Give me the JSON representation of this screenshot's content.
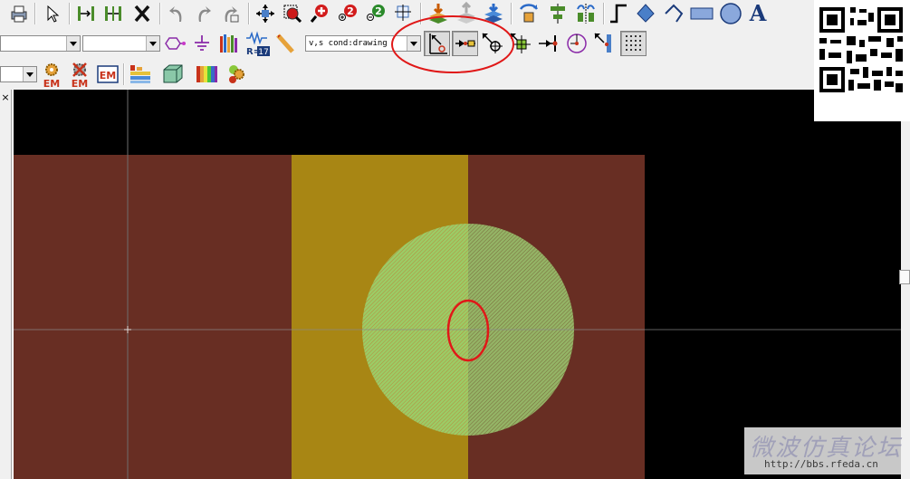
{
  "toolbar": {
    "top_row": {
      "icons": [
        "print-icon",
        "select-pointer-icon",
        "dimension-left-icon",
        "dimension-both-icon",
        "delete-x-icon",
        "undo-icon",
        "redo-icon",
        "repeat-icon",
        "pan-move-icon",
        "zoom-box-icon",
        "zoom-in-icon",
        "zoom-out-icon",
        "zoom-fit-icon",
        "layer-down-icon",
        "layer-up-icon",
        "layer-stack-icon",
        "flip-rotate-icon",
        "align-center-icon",
        "mirror-icon",
        "polyline-icon",
        "polygon-icon",
        "arc-shape-icon",
        "rectangle-icon",
        "circle-icon",
        "text-icon"
      ],
      "text_tool_label": "A"
    },
    "middle_row": {
      "combo1_value": "",
      "combo2_value": "",
      "drawing_mode_combo": "v,s cond:drawing",
      "r_label": "R=",
      "r_value": "17",
      "icons": [
        "port-hexagon-icon",
        "ground-icon",
        "library-books-icon",
        "resistor-icon",
        "pencil-icon",
        "snap-to-grid-icon",
        "snap-midpoint-icon",
        "snap-intersection-icon",
        "snap-vertex-icon",
        "snap-endpoint-icon",
        "snap-center-icon",
        "snap-edge-icon",
        "snap-grid-dots-icon"
      ]
    },
    "bottom_row": {
      "combo_value": "",
      "em_label_1": "EM",
      "em_label_2": "EM",
      "em_label_3": "EM",
      "icons": [
        "em-setup-gear-icon",
        "em-disable-icon",
        "em-box-icon",
        "substrate-layers-icon",
        "3d-box-icon",
        "color-spectrum-icon",
        "simulation-run-icon"
      ]
    }
  },
  "side_panel": {
    "close_label": "×"
  },
  "canvas": {
    "background_color": "#000000",
    "substrate_color": "#6a2e22",
    "trace_color": "#a88614",
    "disc_color": "#8fbe5c",
    "crosshair_color": "#7a7a7a",
    "highlight_color": "#e01818"
  },
  "overlay": {
    "watermark_title": "微波仿真论坛",
    "watermark_url": "http://bbs.rfeda.cn"
  }
}
